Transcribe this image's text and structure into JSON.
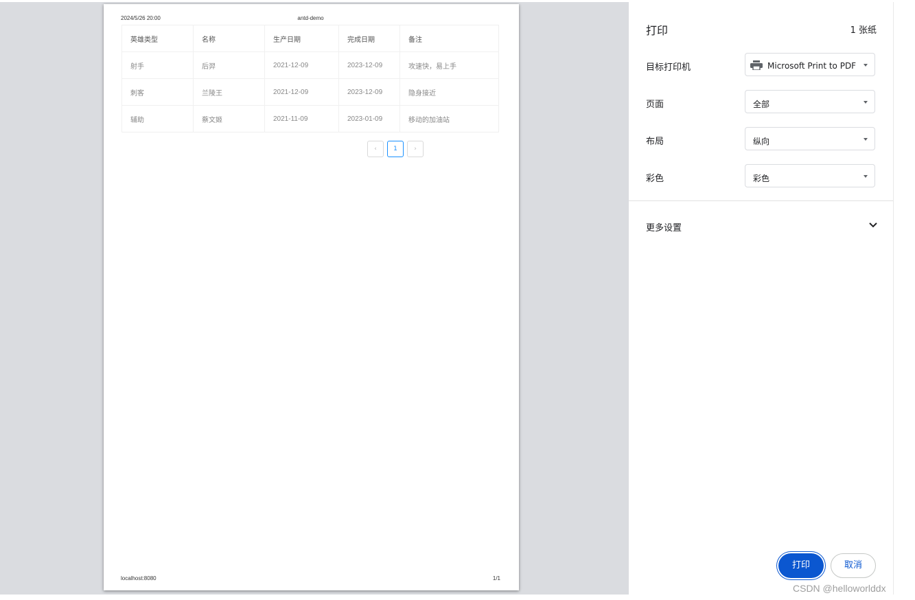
{
  "preview": {
    "header_datetime": "2024/5/26 20:00",
    "header_title": "antd-demo",
    "footer_url": "localhost:8080",
    "footer_page": "1/1",
    "table": {
      "columns": [
        "英雄类型",
        "名称",
        "生产日期",
        "完成日期",
        "备注"
      ],
      "rows": [
        [
          "射手",
          "后羿",
          "2021-12-09",
          "2023-12-09",
          "攻速快，易上手"
        ],
        [
          "刺客",
          "兰陵王",
          "2021-12-09",
          "2023-12-09",
          "隐身接近"
        ],
        [
          "辅助",
          "蔡文姬",
          "2021-11-09",
          "2023-01-09",
          "移动的加油站"
        ]
      ]
    },
    "pagination": {
      "prev": "‹",
      "current": "1",
      "next": "›"
    }
  },
  "panel": {
    "title": "打印",
    "sheet_count": "1 张纸",
    "destination": {
      "label": "目标打印机",
      "value": "Microsoft Print to PDF",
      "icon": "printer-icon"
    },
    "pages": {
      "label": "页面",
      "value": "全部"
    },
    "layout": {
      "label": "布局",
      "value": "纵向"
    },
    "color": {
      "label": "彩色",
      "value": "彩色"
    },
    "more_settings": "更多设置",
    "print_button": "打印",
    "cancel_button": "取消",
    "accent_color": "#0b57d0"
  },
  "watermark": "CSDN @helloworlddx"
}
